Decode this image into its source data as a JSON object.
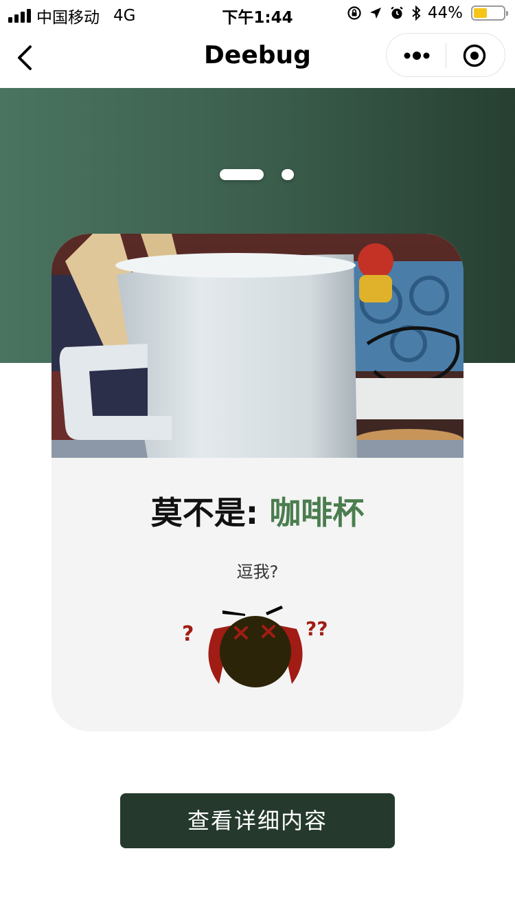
{
  "status_bar": {
    "carrier": "中国移动",
    "network": "4G",
    "time": "下午1:44",
    "battery_percent": "44%",
    "battery_level": 0.44,
    "battery_color": "#f5c518",
    "icons": [
      "signal-icon",
      "rotation-lock-icon",
      "location-arrow-icon",
      "alarm-icon",
      "bluetooth-icon",
      "battery-icon"
    ]
  },
  "nav": {
    "title": "Deebug",
    "icons": [
      "back-chevron-icon",
      "more-dots-icon",
      "target-icon"
    ]
  },
  "carousel": {
    "pages": 2,
    "active_index": 0
  },
  "card": {
    "photo_alt": "coffee mug photo",
    "title_prefix": "莫不是:",
    "title_answer": "咖啡杯",
    "subtitle": "逗我?",
    "mascot_icon": "confused-face-icon",
    "mascot_marks": [
      "?",
      "??"
    ]
  },
  "button": {
    "label": "查看详细内容"
  },
  "colors": {
    "accent_green": "#4b7d4f",
    "button_dark": "#253a2d",
    "hero_left": "#4a7460",
    "hero_right": "#263f31",
    "mascot_red": "#a11c14",
    "mascot_face": "#2b2408"
  }
}
